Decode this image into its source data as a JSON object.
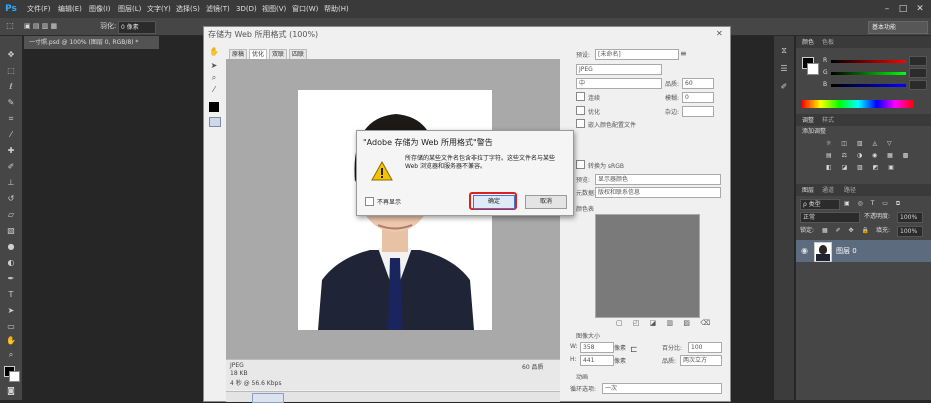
{
  "app": {
    "logo": "Ps"
  },
  "menu": [
    "文件(F)",
    "编辑(E)",
    "图像(I)",
    "图层(L)",
    "文字(Y)",
    "选择(S)",
    "滤镜(T)",
    "3D(D)",
    "视图(V)",
    "窗口(W)",
    "帮助(H)"
  ],
  "options_bar": {
    "feather_label": "羽化:",
    "feather_value": "0 像素",
    "preset": "基本功能"
  },
  "document_tab": {
    "label": "一寸照.psd @ 100% (图层 0, RGB/8) *"
  },
  "save_for_web": {
    "title": "存储为 Web 所用格式 (100%)",
    "close": "✕",
    "tabs": [
      "原稿",
      "优化",
      "双联",
      "四联"
    ],
    "preset_label": "预设:",
    "preset_value": "[未命名]",
    "format_value": "JPEG",
    "quality_level": "中",
    "quality_label": "品质:",
    "quality_value": "60",
    "progressive_label": "连续",
    "blur_label": "模糊:",
    "blur_value": "0",
    "optimized_label": "优化",
    "matte_label": "杂边:",
    "embed_profile_label": "嵌入颜色配置文件",
    "convert_srgb_label": "转换为 sRGB",
    "preview_label": "预览:",
    "preview_value": "显示器颜色",
    "metadata_label": "元数据:",
    "metadata_value": "版权和联系信息",
    "color_table_label": "颜色表",
    "image_size_label": "图像大小",
    "width_label": "W:",
    "width_value": "358",
    "height_label": "H:",
    "height_value": "441",
    "px_unit": "像素",
    "percent_label": "百分比:",
    "percent_value": "100",
    "quality_mode_label": "品质:",
    "quality_mode_value": "两次立方",
    "animation_label": "动画",
    "loop_label": "循环选项:",
    "loop_value": "一次",
    "info_format": "JPEG",
    "info_size": "18 KB",
    "info_time": "4 秒 @ 56.6 Kbps",
    "info_quality": "60 品质"
  },
  "alert": {
    "title": "\"Adobe 存储为 Web 所用格式\"警告",
    "message": "所存储的某些文件名包含非拉丁字符。这些文件名与某些 Web 浏览器和服务器不兼容。",
    "dont_show": "不再显示",
    "ok": "确定",
    "cancel": "取消"
  },
  "panels": {
    "color_tabs": [
      "颜色",
      "色板"
    ],
    "channels": [
      "R",
      "G",
      "B"
    ],
    "adjust_tabs": [
      "调整",
      "样式"
    ],
    "add_adjust": "添加调整",
    "layers_tabs": [
      "图层",
      "通道",
      "路径"
    ],
    "kind_label": "ρ 类型",
    "blend_mode": "正常",
    "opacity_label": "不透明度:",
    "opacity_value": "100%",
    "lock_label": "锁定:",
    "fill_label": "填充:",
    "fill_value": "100%",
    "layer_name": "图层 0"
  },
  "colors": {
    "accent": "#31a8ff",
    "alert_highlight": "#e02020"
  }
}
